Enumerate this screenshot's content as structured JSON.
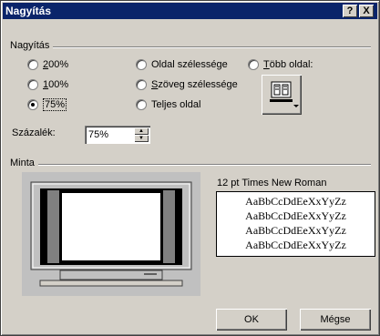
{
  "window": {
    "title": "Nagyítás",
    "help_button": "?",
    "close_button": "X"
  },
  "zoom_group": {
    "label": "Nagyítás",
    "options": [
      {
        "label": "200%",
        "selected": false
      },
      {
        "label": "100%",
        "selected": false
      },
      {
        "label": "75%",
        "selected": true
      },
      {
        "label": "Oldal szélessége",
        "selected": false
      },
      {
        "label": "Szöveg szélessége",
        "selected": false
      },
      {
        "label": "Teljes oldal",
        "selected": false
      },
      {
        "label": "Több oldal:",
        "selected": false
      }
    ],
    "multipage_icon": "multi-page-monitor-icon"
  },
  "percent": {
    "label": "Százalék:",
    "value": "75%"
  },
  "preview_group": {
    "label": "Minta",
    "font_label": "12 pt Times New Roman",
    "sample_lines": [
      "AaBbCcDdEeXxYyZz",
      "AaBbCcDdEeXxYyZz",
      "AaBbCcDdEeXxYyZz",
      "AaBbCcDdEeXxYyZz"
    ]
  },
  "buttons": {
    "ok": "OK",
    "cancel": "Mégse"
  }
}
